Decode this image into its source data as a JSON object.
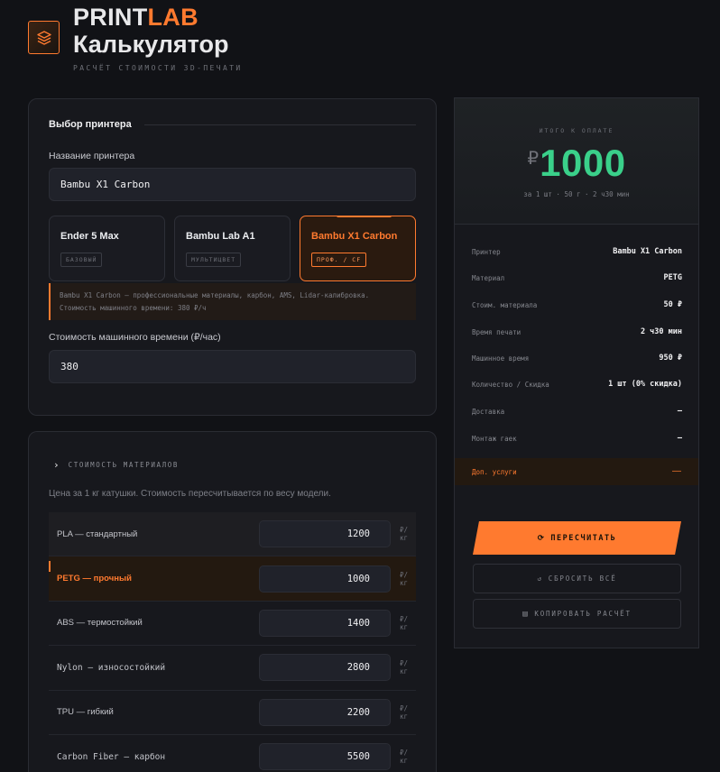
{
  "header": {
    "brand_main": "PRINT",
    "brand_accent": "LAB",
    "title": "Калькулятор",
    "tagline": "РАСЧЁТ СТОИМОСТИ 3D-ПЕЧАТИ",
    "logo_icon": "layers-icon"
  },
  "printer": {
    "section_title": "Выбор принтера",
    "name_label": "Название принтера",
    "name_value": "Bambu X1 Carbon",
    "cards": [
      {
        "name": "Ender 5 Max",
        "tag": "БАЗОВЫЙ",
        "active": false
      },
      {
        "name": "Bambu Lab A1",
        "tag": "МУЛЬТИЦВЕТ",
        "active": false
      },
      {
        "name": "Bambu X1 Carbon",
        "tag": "ПРОФ. / CF",
        "active": true
      }
    ],
    "note_line1": "Bambu X1 Carbon — профессиональные материалы, карбон, AMS, Lidar-калибровка.",
    "note_line2": "Стоимость машинного времени: 380 ₽/ч",
    "machine_label": "Стоимость машинного времени (₽/час)",
    "machine_value": "380"
  },
  "materials": {
    "section_title": "СТОИМОСТЬ МАТЕРИАЛОВ",
    "description": "Цена за 1 кг катушки. Стоимость пересчитывается по весу модели.",
    "unit": "₽/кг",
    "rows": [
      {
        "name": "PLA — стандартный",
        "price": "1200",
        "active": false
      },
      {
        "name": "PETG — прочный",
        "price": "1000",
        "active": true
      },
      {
        "name": "ABS — термостойкий",
        "price": "1400",
        "active": false
      },
      {
        "name": "Nylon — износостойкий",
        "price": "2800",
        "active": false
      },
      {
        "name": "TPU — гибкий",
        "price": "2200",
        "active": false
      },
      {
        "name": "Carbon Fiber — карбон",
        "price": "5500",
        "active": false
      }
    ]
  },
  "summary": {
    "label": "ИТОГО К ОПЛАТЕ",
    "currency": "₽",
    "amount": "1000",
    "sub": "за 1 шт · 50 г · 2 ч30 мин",
    "rows": [
      {
        "k": "Принтер",
        "v": "Bambu X1 Carbon"
      },
      {
        "k": "Материал",
        "v": "PETG"
      },
      {
        "k": "Стоим. материала",
        "v": "50 ₽"
      },
      {
        "k": "Время печати",
        "v": "2 ч30 мин"
      },
      {
        "k": "Машинное время",
        "v": "950 ₽"
      },
      {
        "k": "Количество / Скидка",
        "v": "1 шт (0% скидка)"
      },
      {
        "k": "Доставка",
        "v": "—"
      },
      {
        "k": "Монтаж гаек",
        "v": "—"
      }
    ],
    "extra": {
      "k": "Доп. услуги",
      "v": "—"
    },
    "recalc_label": "ПЕРЕСЧИТАТЬ",
    "reset_label": "СБРОСИТЬ ВСЁ",
    "copy_label": "КОПИРОВАТЬ РАСЧЁТ",
    "amount_color": "#3ad08a",
    "accent_color": "#ff7a2f"
  }
}
